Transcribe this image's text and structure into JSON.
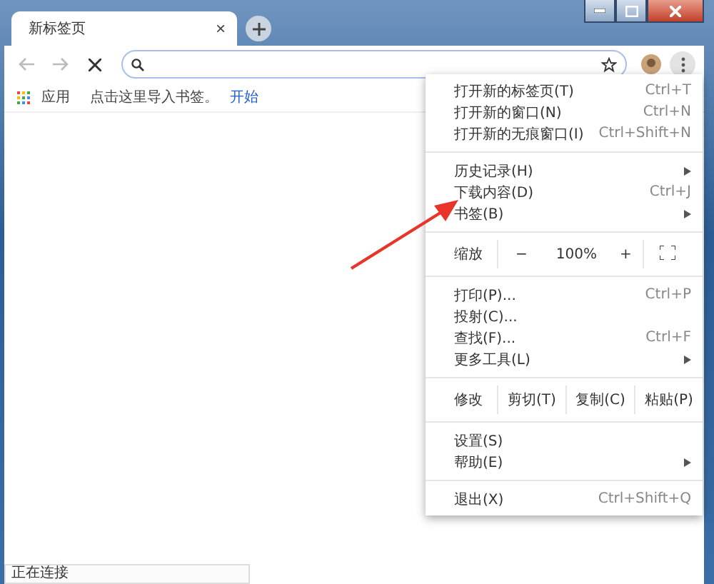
{
  "tab": {
    "title": "新标签页",
    "close": "×"
  },
  "toolbar": {
    "loading": true
  },
  "bookmarks_bar": {
    "apps_label": "应用",
    "hint": "点击这里导入书签。",
    "link": "开始"
  },
  "menu": [
    {
      "kind": "item",
      "label": "打开新的标签页(T)",
      "shortcut": "Ctrl+T",
      "submenu": false
    },
    {
      "kind": "item",
      "label": "打开新的窗口(N)",
      "shortcut": "Ctrl+N",
      "submenu": false
    },
    {
      "kind": "item",
      "label": "打开新的无痕窗口(I)",
      "shortcut": "Ctrl+Shift+N",
      "submenu": false
    },
    {
      "kind": "separator"
    },
    {
      "kind": "item",
      "label": "历史记录(H)",
      "submenu": true
    },
    {
      "kind": "item",
      "label": "下载内容(D)",
      "shortcut": "Ctrl+J",
      "submenu": false
    },
    {
      "kind": "item",
      "label": "书签(B)",
      "submenu": true
    },
    {
      "kind": "separator"
    },
    {
      "kind": "zoom",
      "label": "缩放",
      "minus": "−",
      "value": "100%",
      "plus": "+"
    },
    {
      "kind": "separator"
    },
    {
      "kind": "item",
      "label": "打印(P)...",
      "shortcut": "Ctrl+P",
      "submenu": false
    },
    {
      "kind": "item",
      "label": "投射(C)...",
      "submenu": false
    },
    {
      "kind": "item",
      "label": "查找(F)...",
      "shortcut": "Ctrl+F",
      "submenu": false
    },
    {
      "kind": "item",
      "label": "更多工具(L)",
      "submenu": true
    },
    {
      "kind": "separator"
    },
    {
      "kind": "edit",
      "label": "修改",
      "buttons": [
        "剪切(T)",
        "复制(C)",
        "粘贴(P)"
      ]
    },
    {
      "kind": "separator"
    },
    {
      "kind": "item",
      "label": "设置(S)",
      "submenu": false
    },
    {
      "kind": "item",
      "label": "帮助(E)",
      "submenu": true
    },
    {
      "kind": "separator"
    },
    {
      "kind": "item",
      "label": "退出(X)",
      "shortcut": "Ctrl+Shift+Q",
      "submenu": false
    }
  ],
  "status": "正在连接"
}
